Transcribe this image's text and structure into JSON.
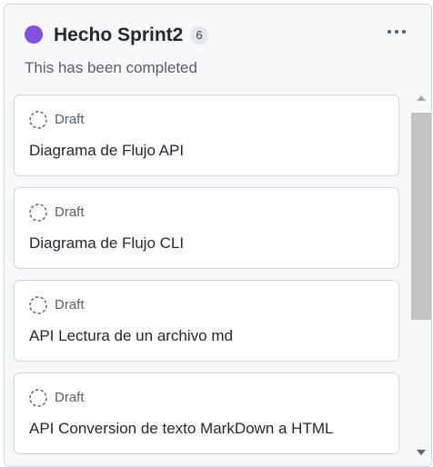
{
  "column": {
    "title": "Hecho Sprint2",
    "count": "6",
    "description": "This has been completed",
    "status_color": "#8250df",
    "menu_icon": "kebab-horizontal-icon"
  },
  "cards": [
    {
      "status": "Draft",
      "status_icon": "draft-circle-icon",
      "title": "Diagrama de Flujo API"
    },
    {
      "status": "Draft",
      "status_icon": "draft-circle-icon",
      "title": "Diagrama de Flujo CLI"
    },
    {
      "status": "Draft",
      "status_icon": "draft-circle-icon",
      "title": "API Lectura de un archivo md"
    },
    {
      "status": "Draft",
      "status_icon": "draft-circle-icon",
      "title": "API Conversion de texto MarkDown a HTML"
    }
  ],
  "colors": {
    "accent": "#8250df",
    "text": "#24292f",
    "muted": "#57606a",
    "border": "#d0d7de",
    "column_bg": "#f6f8fa"
  }
}
